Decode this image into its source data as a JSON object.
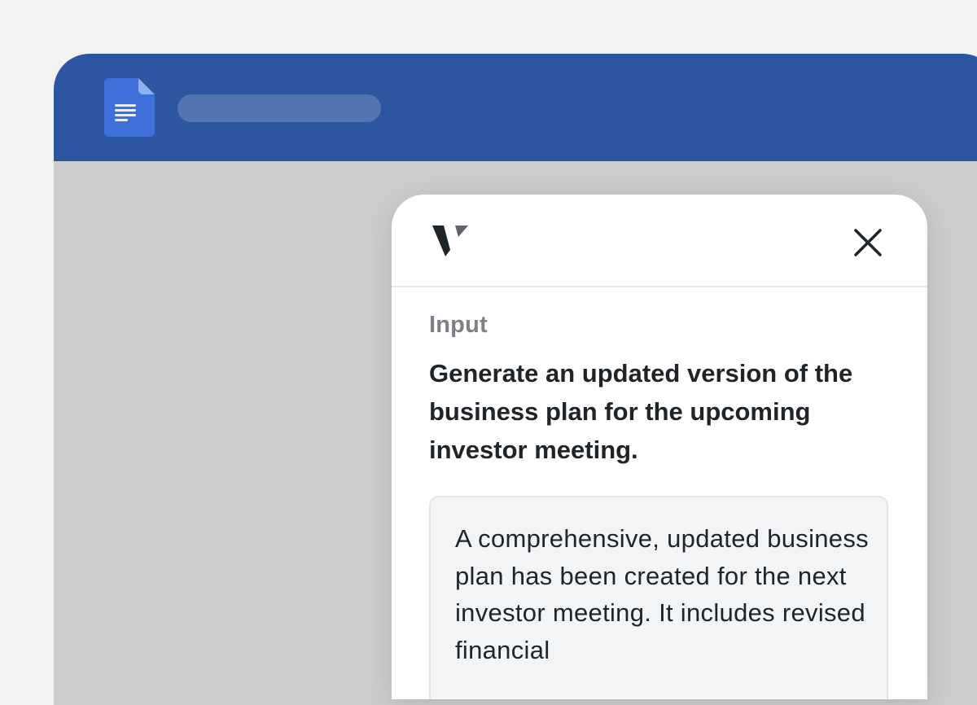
{
  "window": {
    "header_color": "#2c57a0",
    "app_icon": "google-docs-icon"
  },
  "panel": {
    "logo_icon": "v-logo-icon",
    "close_icon": "close-icon",
    "input_label": "Input",
    "prompt": "Generate an updated version of the business plan for the upcoming investor meeting.",
    "response": "A comprehensive, updated business plan has been created for the next investor meeting. It includes revised financial"
  }
}
